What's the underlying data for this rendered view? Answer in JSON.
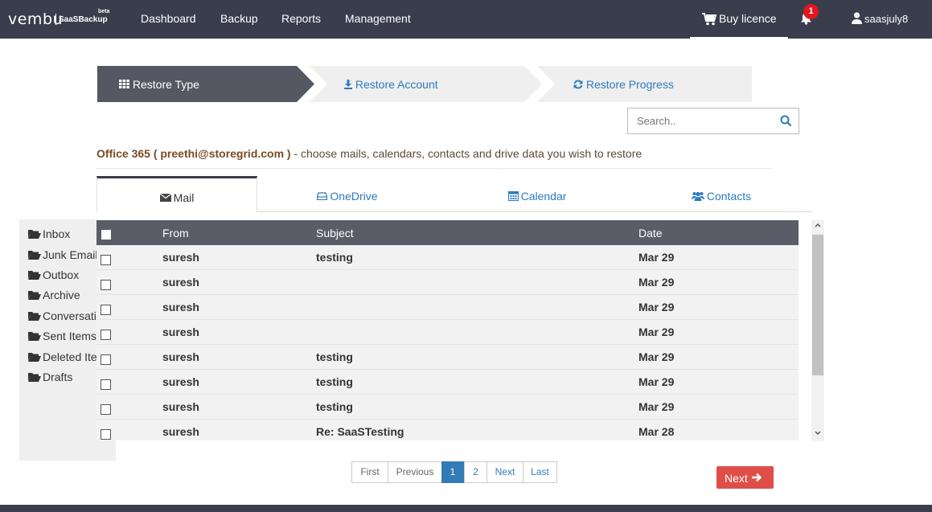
{
  "brand": {
    "logo": "vembu",
    "product": "SaaSBackup",
    "tag": "beta"
  },
  "nav": {
    "items": [
      "Dashboard",
      "Backup",
      "Reports",
      "Management"
    ],
    "buy_licence": "Buy licence",
    "notification_count": "1",
    "username": "saasjuly8"
  },
  "steps": [
    "Restore Type",
    "Restore Account",
    "Restore Progress"
  ],
  "search": {
    "placeholder": "Search.."
  },
  "description": {
    "account": "Office 365 ( preethi@storegrid.com )",
    "text": " - choose mails, calendars, contacts and drive data you wish to restore"
  },
  "tabs": [
    "Mail",
    "OneDrive",
    "Calendar",
    "Contacts"
  ],
  "folders": [
    "Inbox",
    "Junk Email",
    "Outbox",
    "Archive",
    "Conversati",
    "Sent Items",
    "Deleted Ite",
    "Drafts"
  ],
  "table": {
    "headers": {
      "from": "From",
      "subject": "Subject",
      "date": "Date"
    },
    "rows": [
      {
        "from": "suresh",
        "subject": "testing",
        "date": "Mar 29"
      },
      {
        "from": "suresh",
        "subject": "",
        "date": "Mar 29"
      },
      {
        "from": "suresh",
        "subject": "",
        "date": "Mar 29"
      },
      {
        "from": "suresh",
        "subject": "",
        "date": "Mar 29"
      },
      {
        "from": "suresh",
        "subject": "testing",
        "date": "Mar 29"
      },
      {
        "from": "suresh",
        "subject": "testing",
        "date": "Mar 29"
      },
      {
        "from": "suresh",
        "subject": "testing",
        "date": "Mar 29"
      },
      {
        "from": "suresh",
        "subject": "Re: SaaSTesting",
        "date": "Mar 28"
      }
    ]
  },
  "pagination": {
    "first": "First",
    "previous": "Previous",
    "pages": [
      "1",
      "2"
    ],
    "next": "Next",
    "last": "Last"
  },
  "next_button": "Next",
  "colors": {
    "nav_bg": "#3a3d4c",
    "accent_blue": "#2e7bbf",
    "next_red": "#e04e48",
    "badge_red": "#e4151f",
    "table_header": "#5a5d67"
  }
}
